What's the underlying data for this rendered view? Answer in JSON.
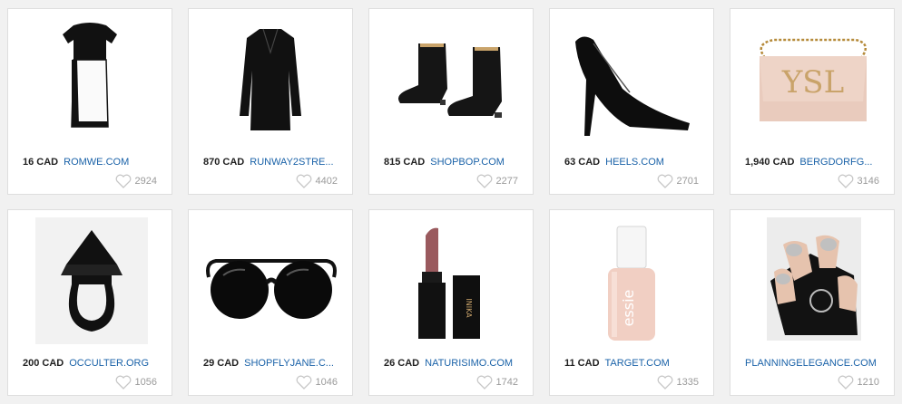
{
  "colors": {
    "background": "#f1f1f1",
    "card": "#ffffff",
    "link": "#1a62a8",
    "price": "#222222",
    "likes": "#9a9a9a"
  },
  "products": [
    {
      "image": "dress",
      "price": "16 CAD",
      "store": "ROMWE.COM",
      "likes": "2924",
      "icon": "heart-icon"
    },
    {
      "image": "coat",
      "price": "870 CAD",
      "store": "RUNWAY2STRE...",
      "likes": "4402",
      "icon": "heart-icon"
    },
    {
      "image": "boots",
      "price": "815 CAD",
      "store": "SHOPBOP.COM",
      "likes": "2277",
      "icon": "heart-icon"
    },
    {
      "image": "pump",
      "price": "63 CAD",
      "store": "HEELS.COM",
      "likes": "2701",
      "icon": "heart-icon"
    },
    {
      "image": "handbag",
      "price": "1,940 CAD",
      "store": "BERGDORFG...",
      "likes": "3146",
      "icon": "heart-icon"
    },
    {
      "image": "ring",
      "price": "200 CAD",
      "store": "OCCULTER.ORG",
      "likes": "1056",
      "icon": "heart-icon"
    },
    {
      "image": "sunglasses",
      "price": "29 CAD",
      "store": "SHOPFLYJANE.C...",
      "likes": "1046",
      "icon": "heart-icon"
    },
    {
      "image": "lipstick",
      "price": "26 CAD",
      "store": "NATURISIMO.COM",
      "likes": "1742",
      "icon": "heart-icon"
    },
    {
      "image": "nail-polish",
      "price": "11 CAD",
      "store": "TARGET.COM",
      "likes": "1335",
      "icon": "heart-icon"
    },
    {
      "image": "manicure",
      "price": "",
      "store": "PLANNINGELEGANCE.COM",
      "likes": "1210",
      "icon": "heart-icon"
    }
  ]
}
